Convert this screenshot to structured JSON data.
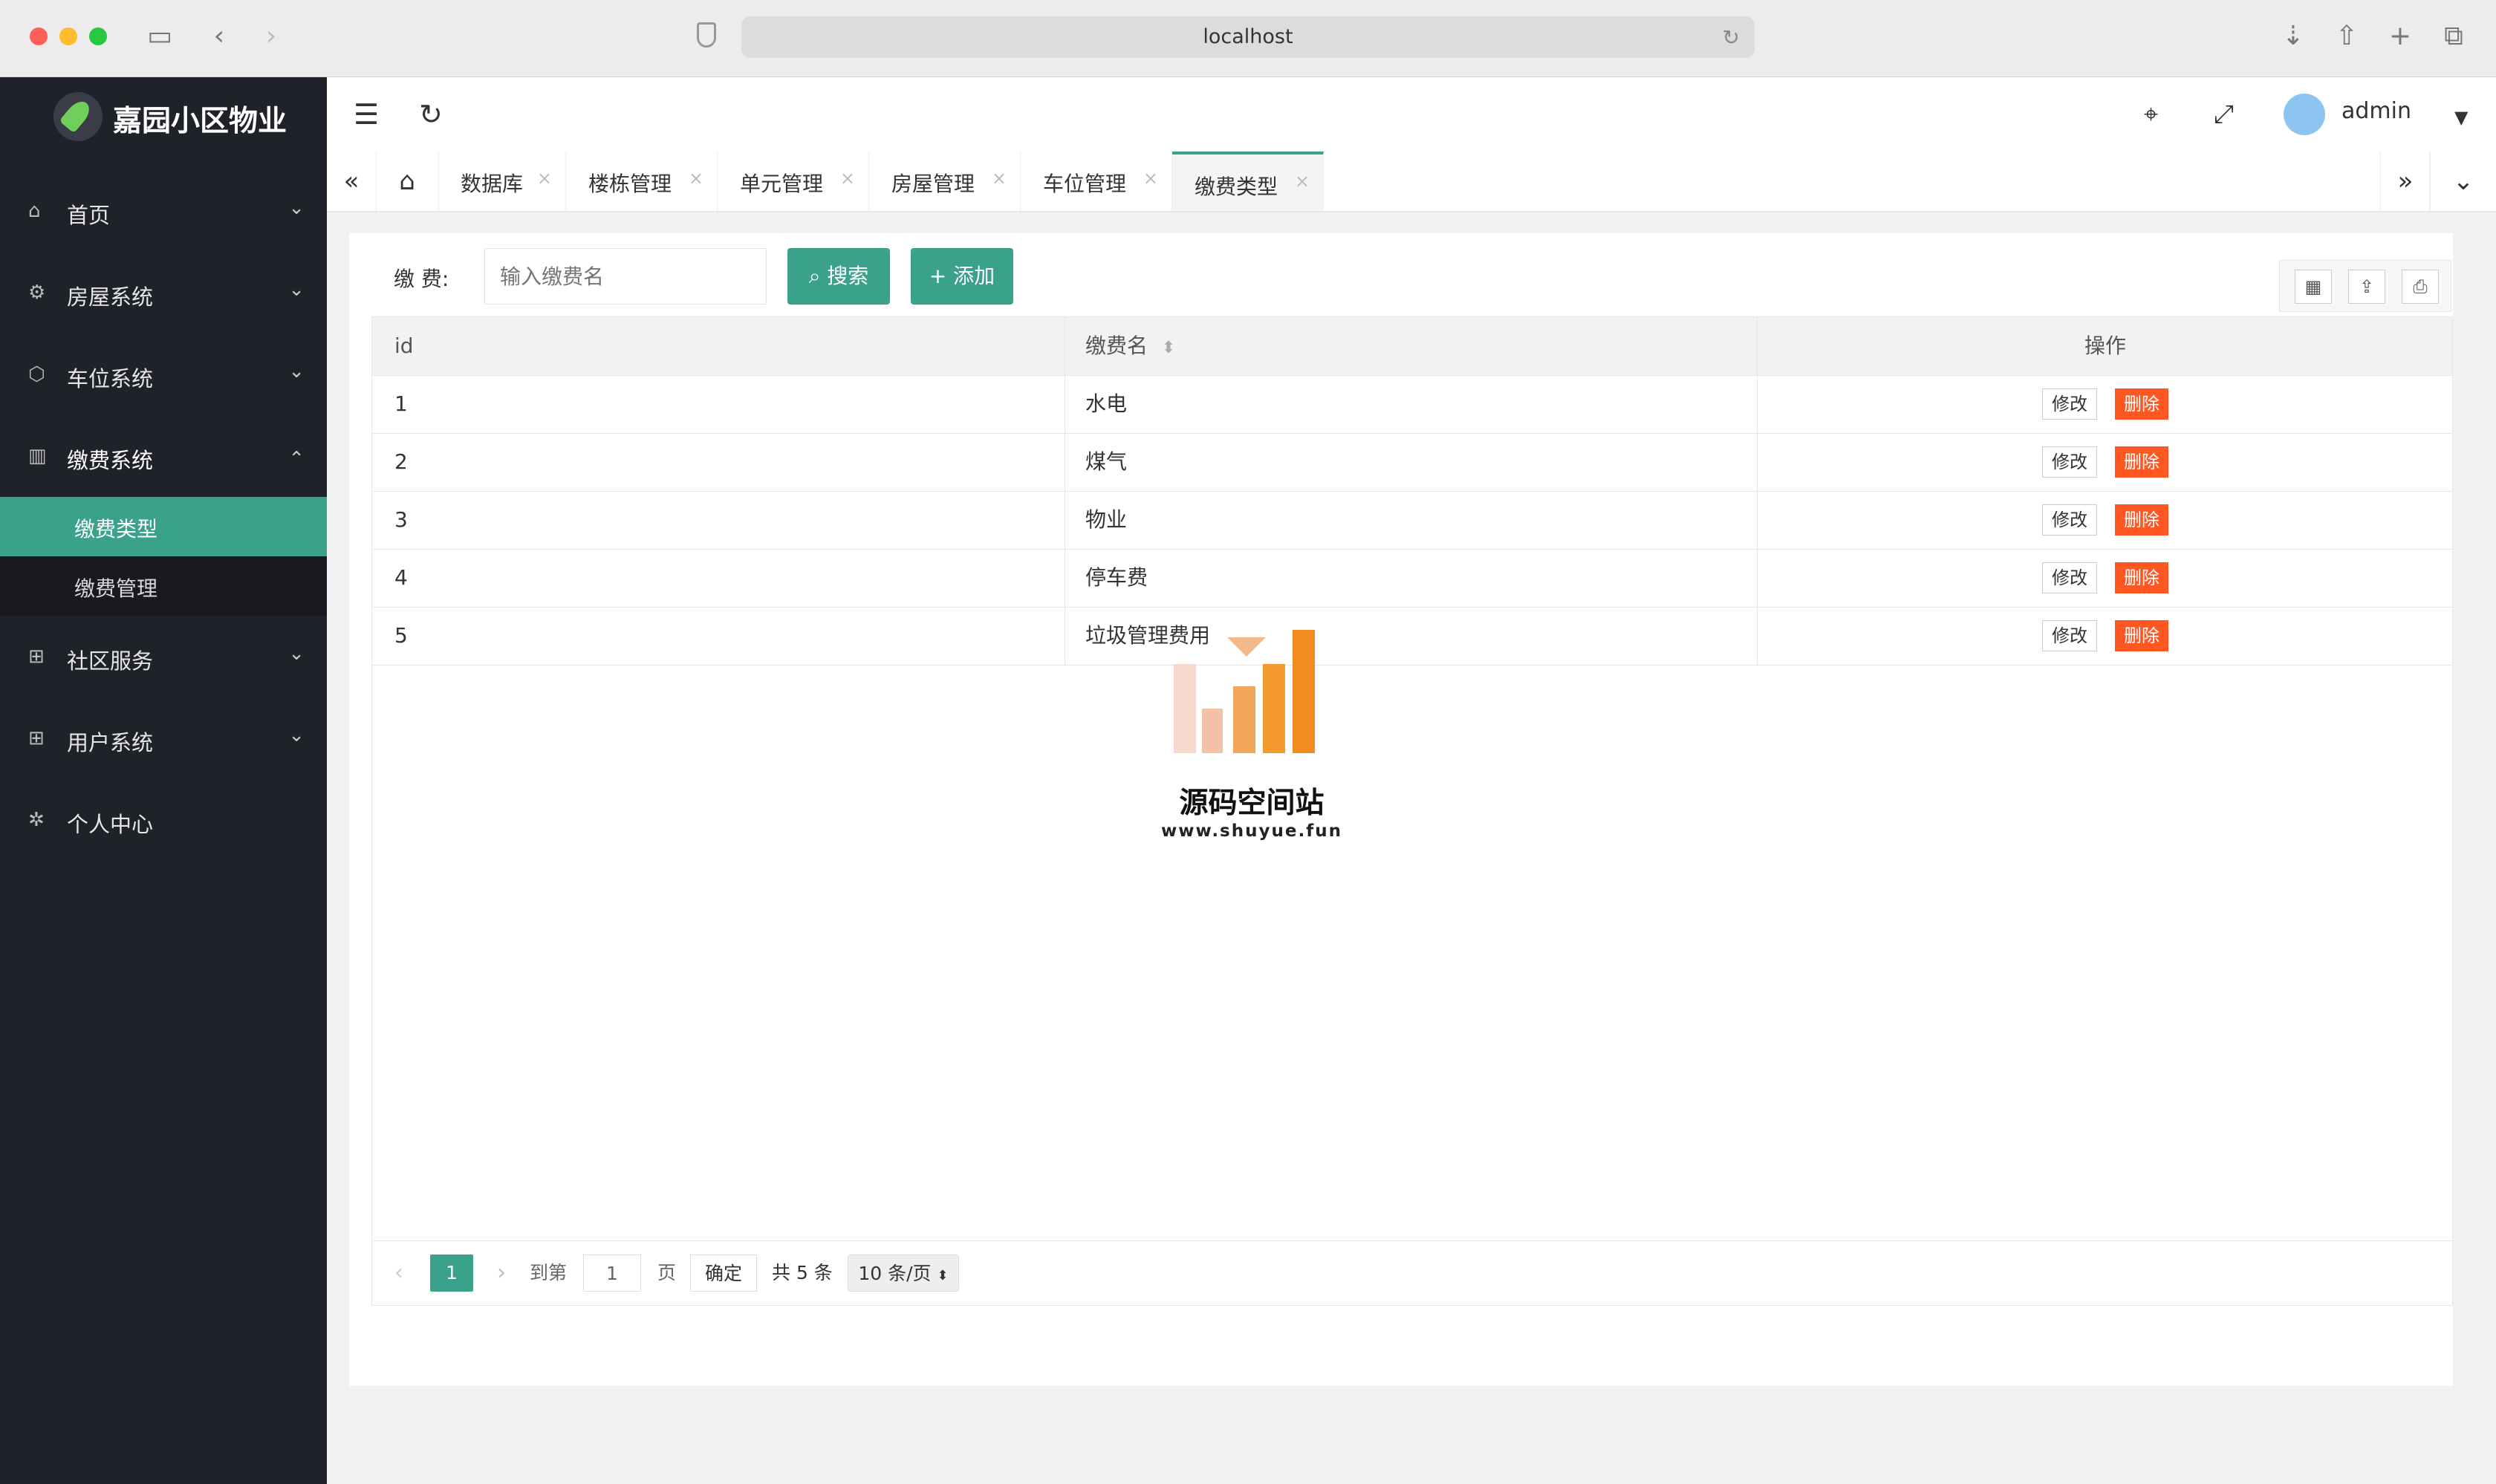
{
  "browser": {
    "url": "localhost"
  },
  "app": {
    "title": "嘉园小区物业"
  },
  "sidebar": {
    "items": [
      {
        "label": "首页",
        "icon": "home-icon",
        "expanded": false
      },
      {
        "label": "房屋系统",
        "icon": "gear-icon",
        "expanded": false
      },
      {
        "label": "车位系统",
        "icon": "cube-icon",
        "expanded": false
      },
      {
        "label": "缴费系统",
        "icon": "building-icon",
        "expanded": true
      },
      {
        "label": "社区服务",
        "icon": "apps-icon",
        "expanded": false
      },
      {
        "label": "用户系统",
        "icon": "apps-icon",
        "expanded": false
      },
      {
        "label": "个人中心",
        "icon": "settings-icon",
        "expanded": false
      }
    ],
    "subitems": [
      {
        "label": "缴费类型",
        "active": true
      },
      {
        "label": "缴费管理",
        "active": false
      }
    ]
  },
  "header": {
    "user": "admin"
  },
  "tabs": [
    {
      "label": "数据库"
    },
    {
      "label": "楼栋管理"
    },
    {
      "label": "单元管理"
    },
    {
      "label": "房屋管理"
    },
    {
      "label": "车位管理"
    },
    {
      "label": "缴费类型",
      "active": true
    }
  ],
  "search": {
    "label": "缴 费:",
    "placeholder": "输入缴费名",
    "search_button": "搜索",
    "add_button": "添加"
  },
  "table": {
    "columns": [
      "id",
      "缴费名",
      "操作"
    ],
    "rows": [
      {
        "id": "1",
        "name": "水电"
      },
      {
        "id": "2",
        "name": "煤气"
      },
      {
        "id": "3",
        "name": "物业"
      },
      {
        "id": "4",
        "name": "停车费"
      },
      {
        "id": "5",
        "name": "垃圾管理费用"
      }
    ],
    "edit_label": "修改",
    "delete_label": "删除"
  },
  "pager": {
    "current_page": "1",
    "goto_label": "到第",
    "goto_value": "1",
    "page_unit": "页",
    "confirm": "确定",
    "total": "共 5 条",
    "page_size": "10 条/页"
  },
  "watermark": {
    "title": "源码空间站",
    "url": "www.shuyue.fun"
  },
  "colors": {
    "accent": "#3aa18a",
    "sidebar_bg": "#20222a",
    "danger": "#ff5722"
  }
}
